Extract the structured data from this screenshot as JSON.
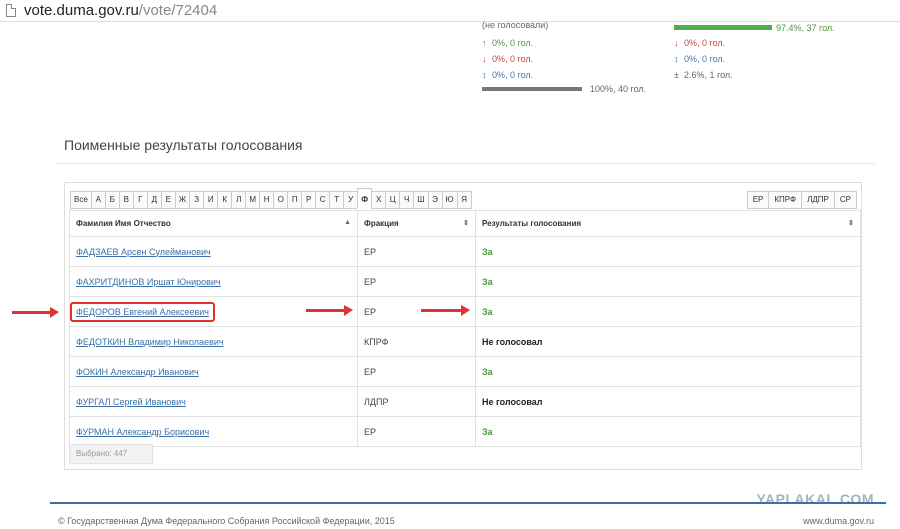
{
  "browser": {
    "url_host": "vote.duma.gov.ru",
    "url_path": "/vote/72404"
  },
  "summary": {
    "not_voted_label": "(не голосовали)",
    "left": [
      "0%, 0 гол.",
      "0%, 0 гол.",
      "0%, 0 гол."
    ],
    "left_syms": [
      "↑",
      "↓",
      "↕"
    ],
    "right": [
      "97.4%, 37 гол.",
      "0%, 0 гол.",
      "0%, 0 гол.",
      "2.6%, 1 гол."
    ],
    "right_syms": [
      "↓",
      "↕",
      "±"
    ],
    "total": "100%, 40 гол.",
    "colors": {
      "yes": "#4cae4c",
      "no": "#cc4444",
      "abstain": "#3b7bbf"
    }
  },
  "section": {
    "title": "Поименные результаты голосования"
  },
  "letters": [
    "Все",
    "А",
    "Б",
    "В",
    "Г",
    "Д",
    "Е",
    "Ж",
    "З",
    "И",
    "К",
    "Л",
    "М",
    "Н",
    "О",
    "П",
    "Р",
    "С",
    "Т",
    "У",
    "Ф",
    "Х",
    "Ц",
    "Ч",
    "Ш",
    "Э",
    "Ю",
    "Я"
  ],
  "active_letter": "Ф",
  "factions": [
    "ЕР",
    "КПРФ",
    "ЛДПР",
    "СР"
  ],
  "table": {
    "headers": [
      "Фамилия Имя Отчество",
      "Фракция",
      "Результаты голосования"
    ],
    "rows": [
      {
        "name": "ФАДЗАЕВ Арсен Сулейманович",
        "faction": "ЕР",
        "result": "За"
      },
      {
        "name": "ФАХРИТДИНОВ Иршат Юнирович",
        "faction": "ЕР",
        "result": "За"
      },
      {
        "name": "ФЕДОРОВ Евгений Алексеевич",
        "faction": "ЕР",
        "result": "За"
      },
      {
        "name": "ФЕДОТКИН Владимир Николаевич",
        "faction": "КПРФ",
        "result": "Не голосовал"
      },
      {
        "name": "ФОКИН Александр Иванович",
        "faction": "ЕР",
        "result": "За"
      },
      {
        "name": "ФУРГАЛ Сергей Иванович",
        "faction": "ЛДПР",
        "result": "Не голосовал"
      },
      {
        "name": "ФУРМАН Александр Борисович",
        "faction": "ЕР",
        "result": "За"
      }
    ],
    "selected_count": "Выбрано: 447"
  },
  "footer": {
    "copyright": "© Государственная Дума Федерального Собрания Российской Федерации, 2015",
    "site": "www.duma.gov.ru",
    "watermark": "YAPLAKAL.COM"
  }
}
